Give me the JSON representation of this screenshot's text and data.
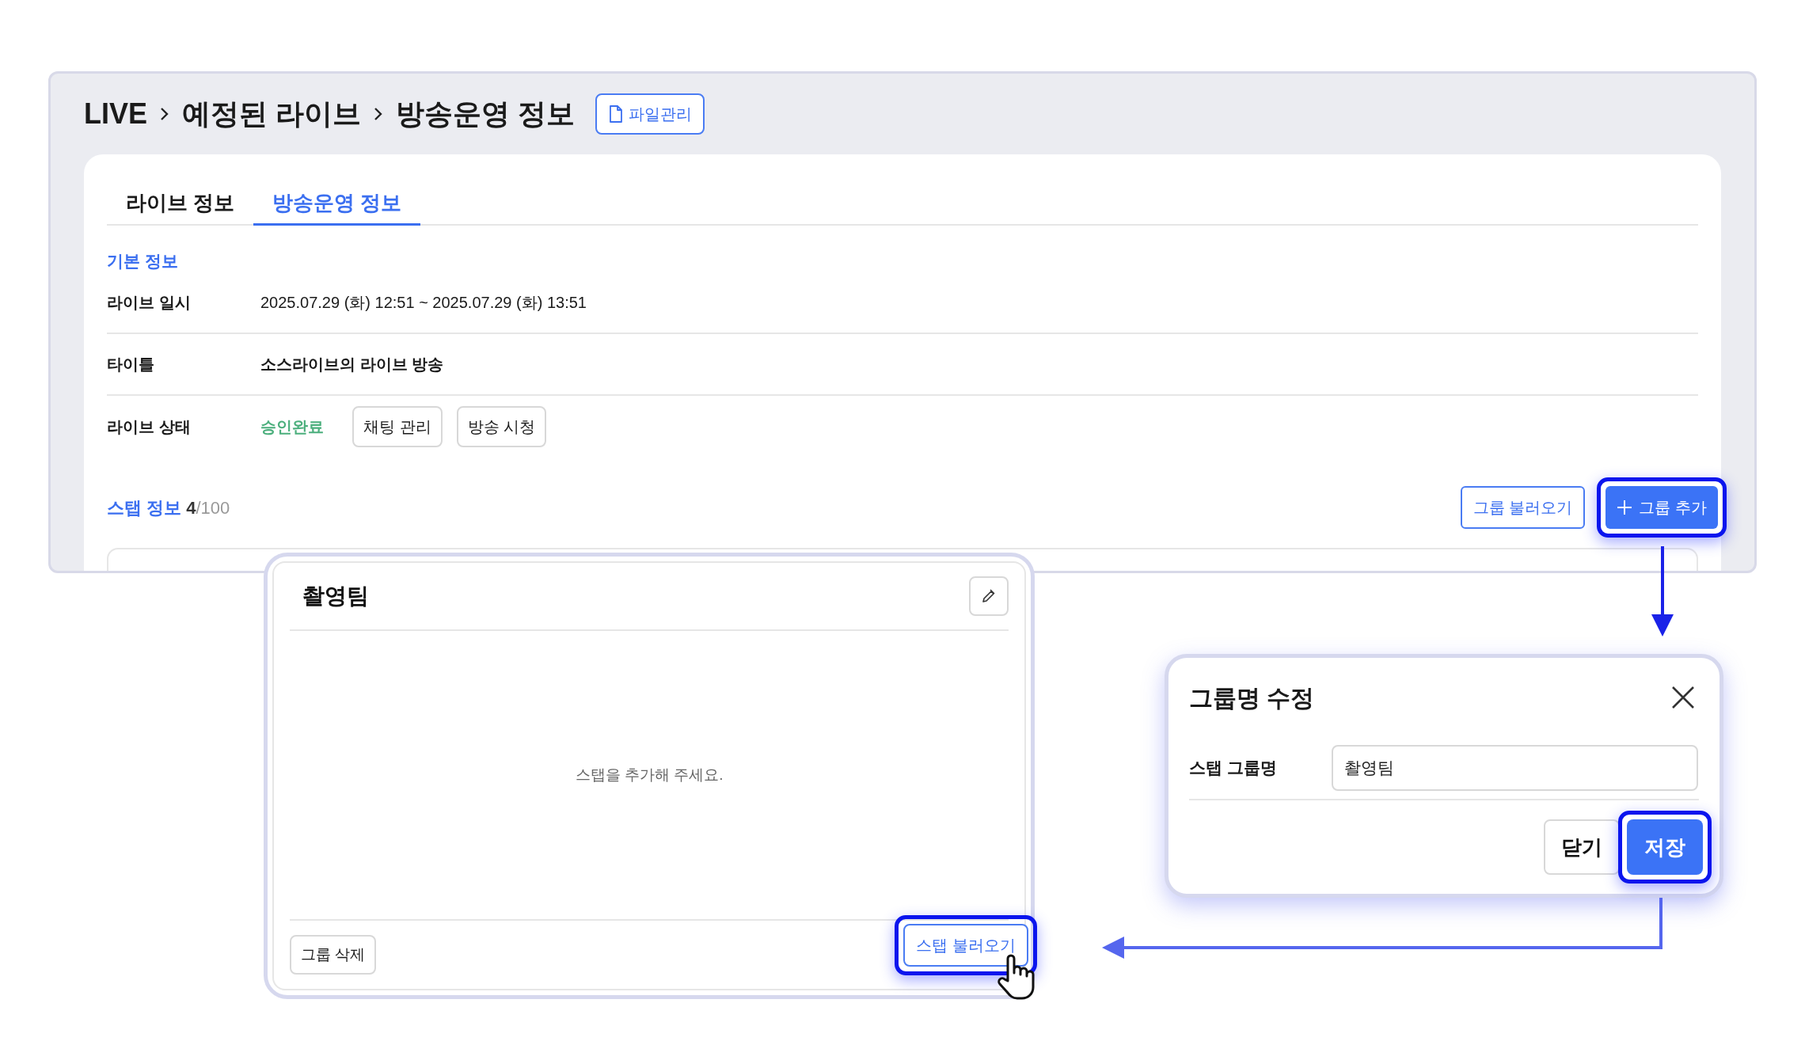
{
  "page": {
    "breadcrumb": [
      "LIVE",
      "예정된 라이브",
      "방송운영 정보"
    ],
    "file_button": "파일관리",
    "tabs": [
      {
        "label": "라이브 정보",
        "selected": false
      },
      {
        "label": "방송운영 정보",
        "selected": true
      }
    ],
    "basic_info": {
      "heading": "기본 정보",
      "rows": [
        {
          "label": "라이브 일시",
          "kind": "text",
          "value": "2025.07.29 (화) 12:51 ~ 2025.07.29 (화) 13:51"
        },
        {
          "label": "타이틀",
          "kind": "bold",
          "value": "소스라이브의 라이브 방송"
        },
        {
          "label": "라이브 상태",
          "kind": "status",
          "value": "승인완료",
          "buttons": [
            "채팅 관리",
            "방송 시청"
          ]
        }
      ]
    },
    "staff": {
      "heading": "스탭 정보",
      "count": "4",
      "total": "/100",
      "buttons": [
        {
          "label": "그룹 불러오기",
          "kind": "outline",
          "highlighted": false
        },
        {
          "label": "그룹 추가",
          "kind": "primary",
          "highlighted": true
        }
      ]
    }
  },
  "group_card": {
    "title": "촬영팀",
    "empty_message": "스탭을 추가해 주세요.",
    "delete_button": "그룹 삭제",
    "load_button": {
      "label": "스탭 불러오기",
      "highlighted": true
    }
  },
  "modal": {
    "title": "그룹명 수정",
    "field_label": "스탭 그룹명",
    "field_value": "촬영팀",
    "buttons": [
      {
        "label": "닫기",
        "kind": "secondary",
        "highlighted": false
      },
      {
        "label": "저장",
        "kind": "primary",
        "highlighted": true
      }
    ]
  }
}
